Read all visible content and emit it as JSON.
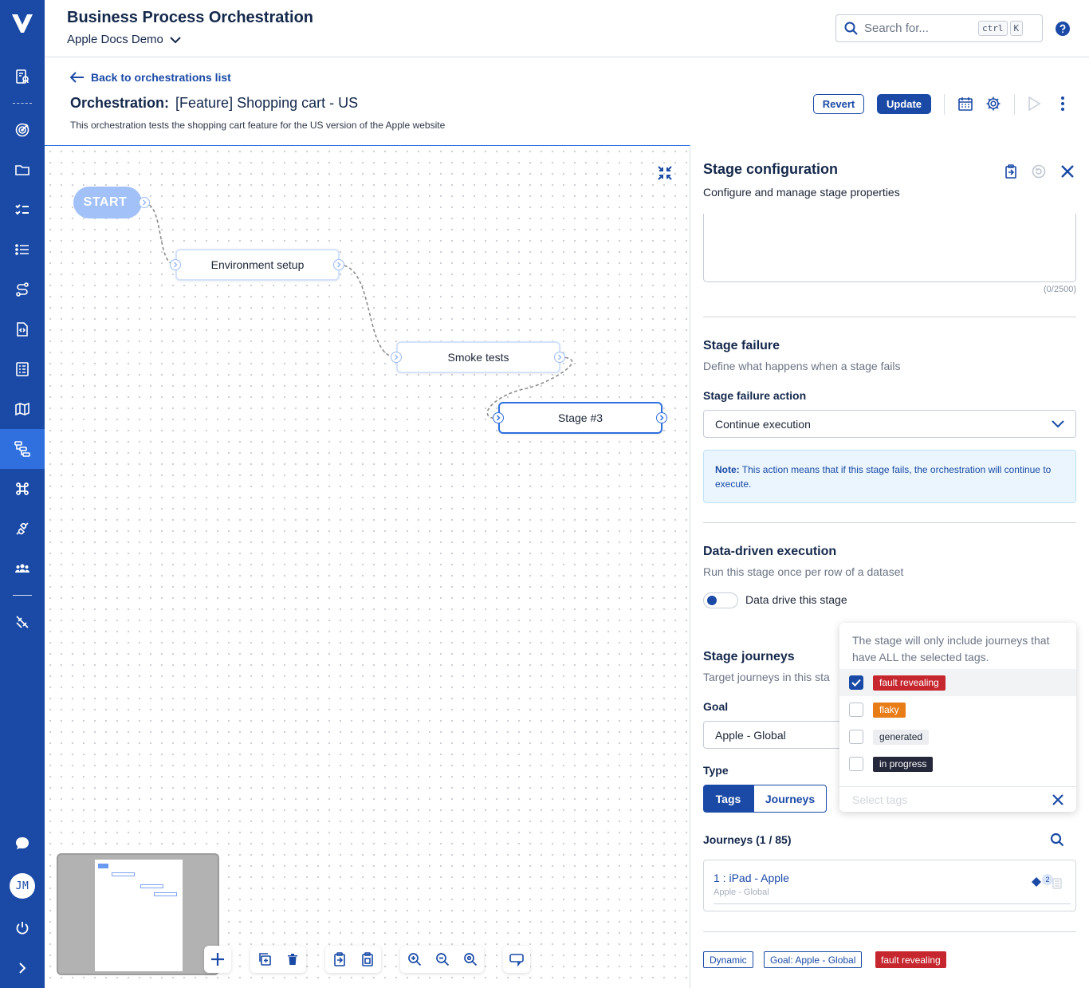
{
  "app": {
    "title": "Business Process Orchestration",
    "workspace": "Apple Docs Demo"
  },
  "search": {
    "placeholder": "Search for...",
    "shortcut_keys": [
      "ctrl",
      "K"
    ]
  },
  "sidebar": {
    "items": [
      "reports-icon",
      "target-icon",
      "folder-icon",
      "checklist-icon",
      "list-icon",
      "route-icon",
      "script-icon",
      "test-plan-icon",
      "map-icon",
      "orchestration-icon",
      "command-icon",
      "integration-icon",
      "team-icon",
      "tools-icon"
    ],
    "active": "orchestration-icon",
    "bottom": [
      "chat-icon",
      "avatar",
      "power-icon",
      "expand-icon"
    ],
    "avatar_initials": "JM"
  },
  "page": {
    "back_label": "Back to orchestrations list",
    "orchestration_label": "Orchestration:",
    "orchestration_name": "[Feature] Shopping cart - US",
    "description": "This orchestration tests the shopping cart feature for the US version of the Apple website",
    "revert_label": "Revert",
    "update_label": "Update"
  },
  "canvas": {
    "start_label": "START",
    "nodes": [
      {
        "label": "Environment setup"
      },
      {
        "label": "Smoke tests"
      },
      {
        "label": "Stage #3",
        "selected": true
      }
    ]
  },
  "panel": {
    "title": "Stage configuration",
    "subtitle": "Configure and manage stage properties",
    "char_counter": "(0/2500)",
    "failure": {
      "title": "Stage failure",
      "subtitle": "Define what happens when a stage fails",
      "action_label": "Stage failure action",
      "action_value": "Continue execution",
      "note_prefix": "Note:",
      "note_text": "This action means that if this stage fails, the orchestration will continue to execute."
    },
    "data_driven": {
      "title": "Data-driven execution",
      "subtitle": "Run this stage once per row of a dataset",
      "toggle_label": "Data drive this stage",
      "enabled": false
    },
    "journeys": {
      "title": "Stage journeys",
      "subtitle": "Target journeys in this sta",
      "goal_label": "Goal",
      "goal_value": "Apple - Global",
      "type_label": "Type",
      "type_options": [
        "Tags",
        "Journeys"
      ],
      "type_selected": "Tags",
      "list_header": "Journeys (1 / 85)",
      "items": [
        {
          "name": "1 : iPad - Apple",
          "goal": "Apple - Global",
          "count": "2"
        }
      ]
    },
    "chips": [
      {
        "label": "Dynamic",
        "style": "outline"
      },
      {
        "label": "Goal: Apple - Global",
        "style": "outline"
      },
      {
        "label": "fault revealing",
        "style": "red"
      }
    ]
  },
  "tags_dropdown": {
    "hint": "The stage will only include journeys that have ALL the selected tags.",
    "options": [
      {
        "label": "fault revealing",
        "checked": true,
        "color": "#c6262e"
      },
      {
        "label": "flaky",
        "checked": false,
        "color": "#e87d17"
      },
      {
        "label": "generated",
        "checked": false,
        "color": "#eceef1"
      },
      {
        "label": "in progress",
        "checked": false,
        "color": "#24283a"
      }
    ],
    "input_placeholder": "Select tags"
  },
  "colors": {
    "brand": "#1a4aa6",
    "accent": "#2f6fde",
    "danger": "#c6262e"
  }
}
